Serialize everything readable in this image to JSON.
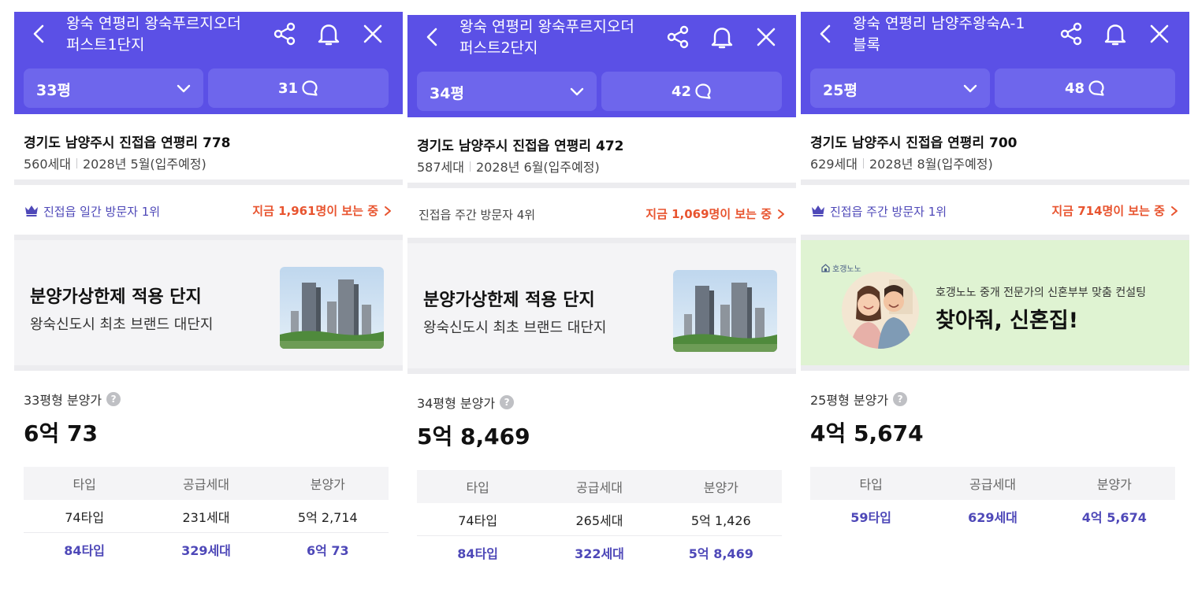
{
  "panels": [
    {
      "title_line1": "왕숙 연평리 왕숙푸르지오더",
      "title_line2": "퍼스트1단지",
      "size": "33평",
      "talk_count": "31",
      "address": "경기도 남양주시 진접읍 연평리 778",
      "households": "560세대",
      "move_in": "2028년 5월(입주예정)",
      "rank_text": "진접읍 일간 방문자 1위",
      "rank_crown": true,
      "live_viewers": "지금 1,961명이 보는 중",
      "banner": {
        "title": "분양가상한제 적용 단지",
        "subtitle": "왕숙신도시 최초 브랜드 대단지"
      },
      "price_label": "33평형 분양가",
      "price": "6억 73",
      "table": {
        "headers": [
          "타입",
          "공급세대",
          "분양가"
        ],
        "rows": [
          [
            "74타입",
            "231세대",
            "5억 2,714"
          ],
          [
            "84타입",
            "329세대",
            "6억 73"
          ]
        ]
      }
    },
    {
      "title_line1": "왕숙 연평리 왕숙푸르지오더",
      "title_line2": "퍼스트2단지",
      "size": "34평",
      "talk_count": "42",
      "address": "경기도 남양주시 진접읍 연평리 472",
      "households": "587세대",
      "move_in": "2028년 6월(입주예정)",
      "rank_text": "진접읍 주간 방문자 4위",
      "rank_crown": false,
      "live_viewers": "지금 1,069명이 보는 중",
      "banner": {
        "title": "분양가상한제 적용 단지",
        "subtitle": "왕숙신도시 최초 브랜드 대단지"
      },
      "price_label": "34평형 분양가",
      "price": "5억 8,469",
      "table": {
        "headers": [
          "타입",
          "공급세대",
          "분양가"
        ],
        "rows": [
          [
            "74타입",
            "265세대",
            "5억 1,426"
          ],
          [
            "84타입",
            "322세대",
            "5억 8,469"
          ]
        ]
      }
    },
    {
      "title_line1": "왕숙 연평리 남양주왕숙A-1",
      "title_line2": "블록",
      "size": "25평",
      "talk_count": "48",
      "address": "경기도 남양주시 진접읍 연평리 700",
      "households": "629세대",
      "move_in": "2028년 8월(입주예정)",
      "rank_text": "진접읍 주간 방문자 1위",
      "rank_crown": true,
      "live_viewers": "지금 714명이 보는 중",
      "ad": {
        "logo": "호갱노노",
        "subtitle": "호갱노노 중개 전문가의 신혼부부 맞춤 컨설팅",
        "title": "찾아줘, 신혼집!"
      },
      "price_label": "25평형 분양가",
      "price": "4억 5,674",
      "table": {
        "headers": [
          "타입",
          "공급세대",
          "분양가"
        ],
        "rows": [
          [
            "59타입",
            "629세대",
            "4억 5,674"
          ]
        ]
      }
    }
  ],
  "colors": {
    "header": "#5b50e6",
    "accent_text": "#4e48b8",
    "live_orange": "#e8542f",
    "ad_background": "#dff3d2"
  },
  "icons": [
    "back-icon",
    "share-icon",
    "bell-icon",
    "close-icon",
    "chevron-down-icon",
    "chat-bubble-icon",
    "crown-icon",
    "chevron-right-icon",
    "help-icon"
  ]
}
